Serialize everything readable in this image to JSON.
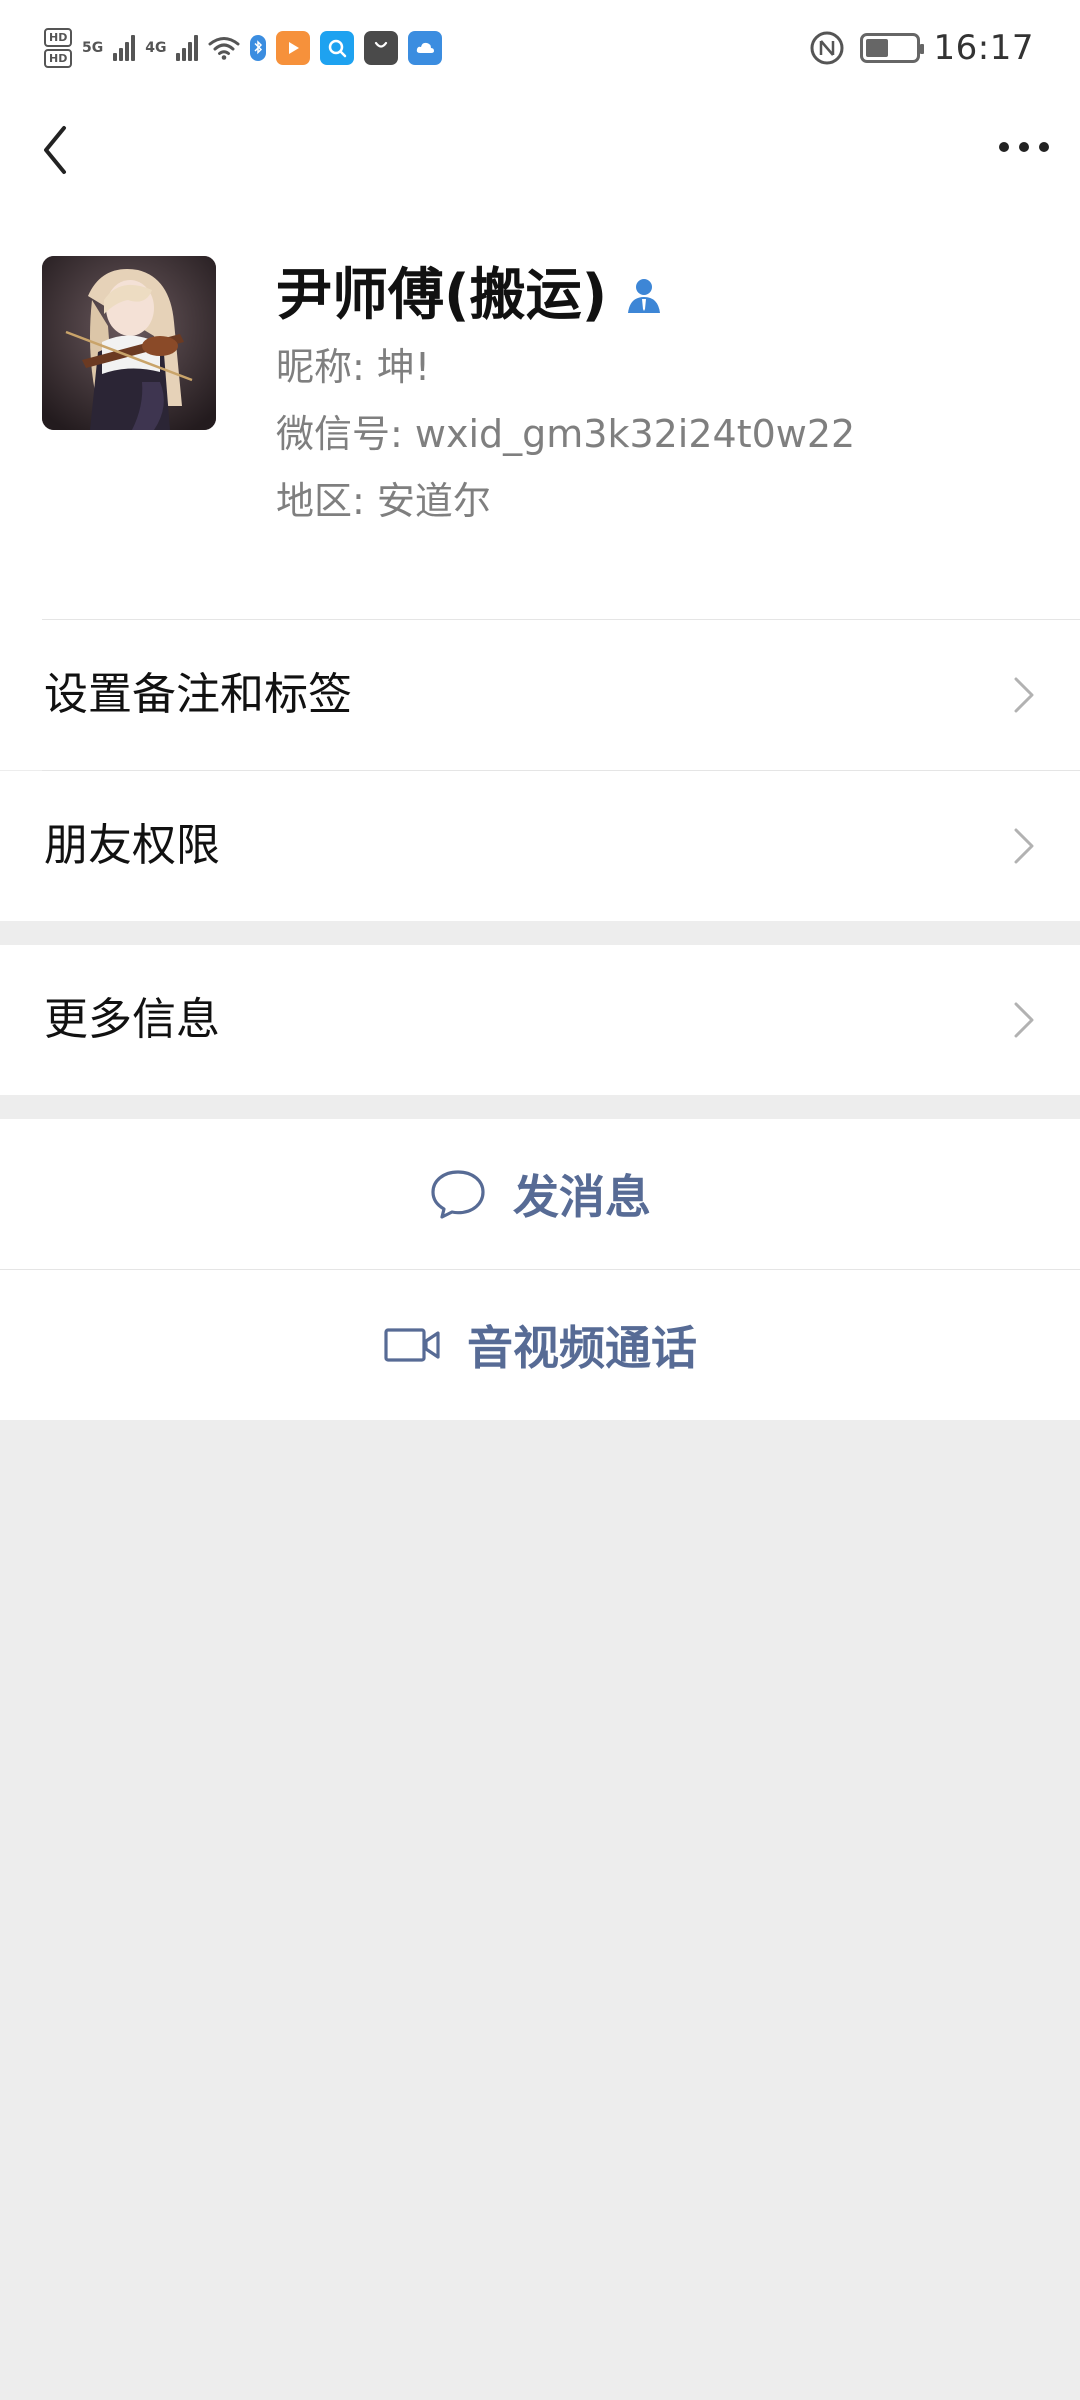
{
  "status_bar": {
    "time": "16:17",
    "sim1_badge": "HD",
    "sim2_badge": "HD",
    "network_1": "5G",
    "network_2": "4G",
    "battery_level": 0.45,
    "icons": [
      "hd-signal-icon",
      "signal-5g-icon",
      "signal-4g-icon",
      "wifi-icon",
      "bluetooth-app-icon",
      "video-app-icon",
      "search-app-icon",
      "shopping-bag-app-icon",
      "cloud-app-icon",
      "nfc-icon",
      "battery-icon"
    ]
  },
  "nav": {
    "back_icon": "chevron-left-icon",
    "more_icon": "more-dots-icon"
  },
  "profile": {
    "display_name": "尹师傅(搬运)",
    "nickname": "昵称: 坤!",
    "wechat_id": "微信号: wxid_gm3k32i24t0w22",
    "region": "地区: 安道尔",
    "badge_icon": "contact-person-icon"
  },
  "menu": {
    "remark_tags": "设置备注和标签",
    "friend_permissions": "朋友权限",
    "more_info": "更多信息"
  },
  "actions": {
    "send_message": "发消息",
    "av_call": "音视频通话"
  },
  "colors": {
    "link_blue": "#576b95",
    "background": "#ededed",
    "badge_blue": "#3d86d6"
  }
}
